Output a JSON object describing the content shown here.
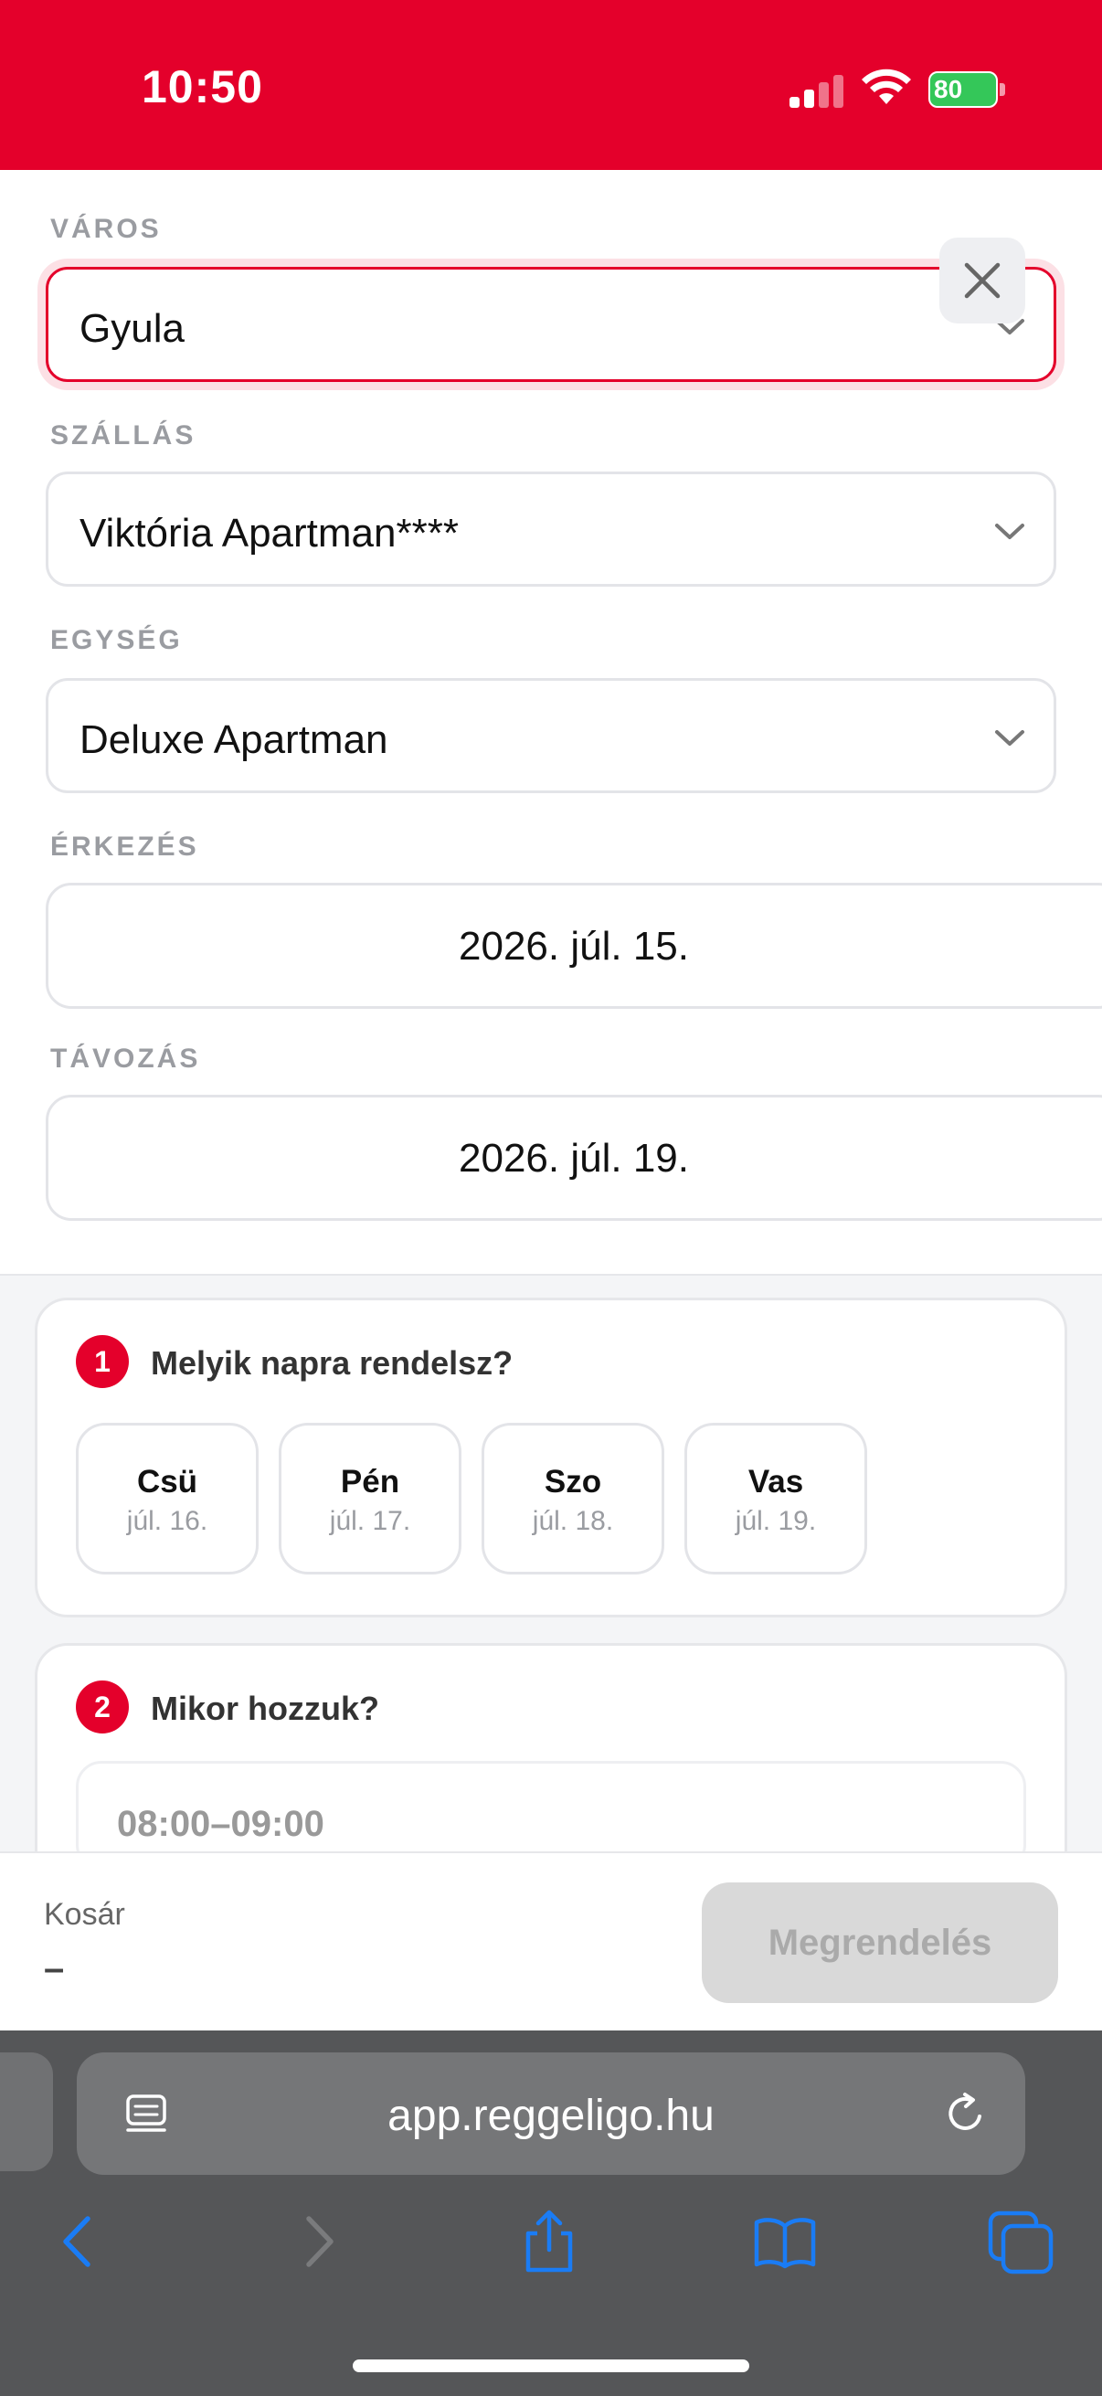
{
  "status_bar": {
    "time": "10:50",
    "battery": "80",
    "accent": "#e4002b"
  },
  "form": {
    "city": {
      "label": "VÁROS",
      "value": "Gyula"
    },
    "accommodation": {
      "label": "SZÁLLÁS",
      "value": "Viktória Apartman****"
    },
    "unit": {
      "label": "EGYSÉG",
      "value": "Deluxe Apartman"
    },
    "arrival": {
      "label": "ÉRKEZÉS",
      "value": "2026. júl. 15."
    },
    "departure": {
      "label": "TÁVOZÁS",
      "value": "2026. júl. 19."
    }
  },
  "step1": {
    "number": "1",
    "title": "Melyik napra rendelsz?",
    "days": [
      {
        "name": "Csü",
        "date": "júl. 16."
      },
      {
        "name": "Pén",
        "date": "júl. 17."
      },
      {
        "name": "Szo",
        "date": "júl. 18."
      },
      {
        "name": "Vas",
        "date": "júl. 19."
      }
    ]
  },
  "step2": {
    "number": "2",
    "title": "Mikor hozzuk?",
    "slot": "08:00–09:00"
  },
  "cart": {
    "label": "Kosár",
    "value": "–",
    "order_button": "Megrendelés"
  },
  "browser": {
    "url": "app.reggeligo.hu",
    "icons": [
      "page-menu-icon",
      "reload-icon",
      "back-icon",
      "forward-icon",
      "share-icon",
      "bookmarks-icon",
      "tabs-icon"
    ]
  }
}
